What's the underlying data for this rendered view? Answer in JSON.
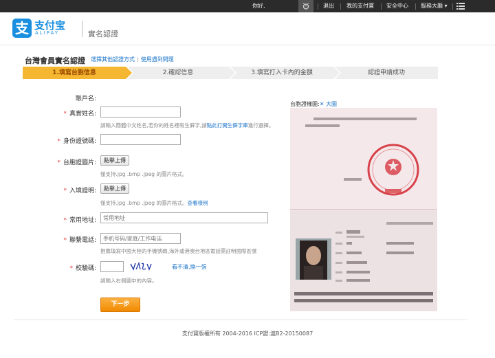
{
  "topbar": {
    "greeting": "你好,",
    "logout": "退出",
    "my_alipay": "我的支付寶",
    "security": "安全中心",
    "service": "服務大廳 ▾"
  },
  "header": {
    "logo_char": "支",
    "logo_text": "支付宝",
    "logo_sub": "ALIPAY",
    "page_name": "實名認證"
  },
  "title": {
    "main": "台灣會員實名認證",
    "link_other": "選擇其他認證方式",
    "link_help": "使用遇到問題"
  },
  "steps": [
    {
      "label": "1.填寫台胞信息",
      "active": true
    },
    {
      "label": "2.確認信息",
      "active": false
    },
    {
      "label": "3.填寫打入卡內的金額",
      "active": false
    },
    {
      "label": "認證申請成功",
      "active": false
    }
  ],
  "form": {
    "account_label": "賬戶名:",
    "name_label": "真實姓名:",
    "name_hint_pre": "請輸入簡體中文姓名,若你的姓名裡有生僻字,請",
    "name_hint_link": "點此打開生僻字庫",
    "name_hint_post": "進行選擇。",
    "id_label": "身份證號碼:",
    "photo_label": "台胞證圖片:",
    "upload_label": "點擊上傳",
    "photo_hint": "僅支持.jpg .bmp .jpeg 的圖片格式。",
    "entry_label": "入境證明:",
    "entry_upload_label": "點擊上傳",
    "entry_hint_pre": "僅支持.jpg .bmp .jpeg 的圖片格式。",
    "entry_hint_link": "查看樣例",
    "address_label": "常用地址:",
    "address_placeholder": "常用地址",
    "phone_label": "聯繫電話:",
    "phone_placeholder": "手机号码/家庭/工作电话",
    "phone_hint": "推薦填寫中國大陸的手機號碼,海外或港澳台地區電話需註明國際區號",
    "captcha_label": "校驗碼:",
    "captcha_link": "看不清,換一張",
    "captcha_hint": "請輸入右側圖中的內容。",
    "next_button": "下一步"
  },
  "sample": {
    "label": "台胞證樣圖:",
    "enlarge": "✕ 大圖"
  },
  "footer": {
    "copyright": "支付寶版權所有 2004-2016 ICP證:滬B2-20150087"
  },
  "colors": {
    "accent": "#1a8fe0",
    "step_active": "#f5b731",
    "required": "#e4393c",
    "link": "#1a73c8"
  }
}
